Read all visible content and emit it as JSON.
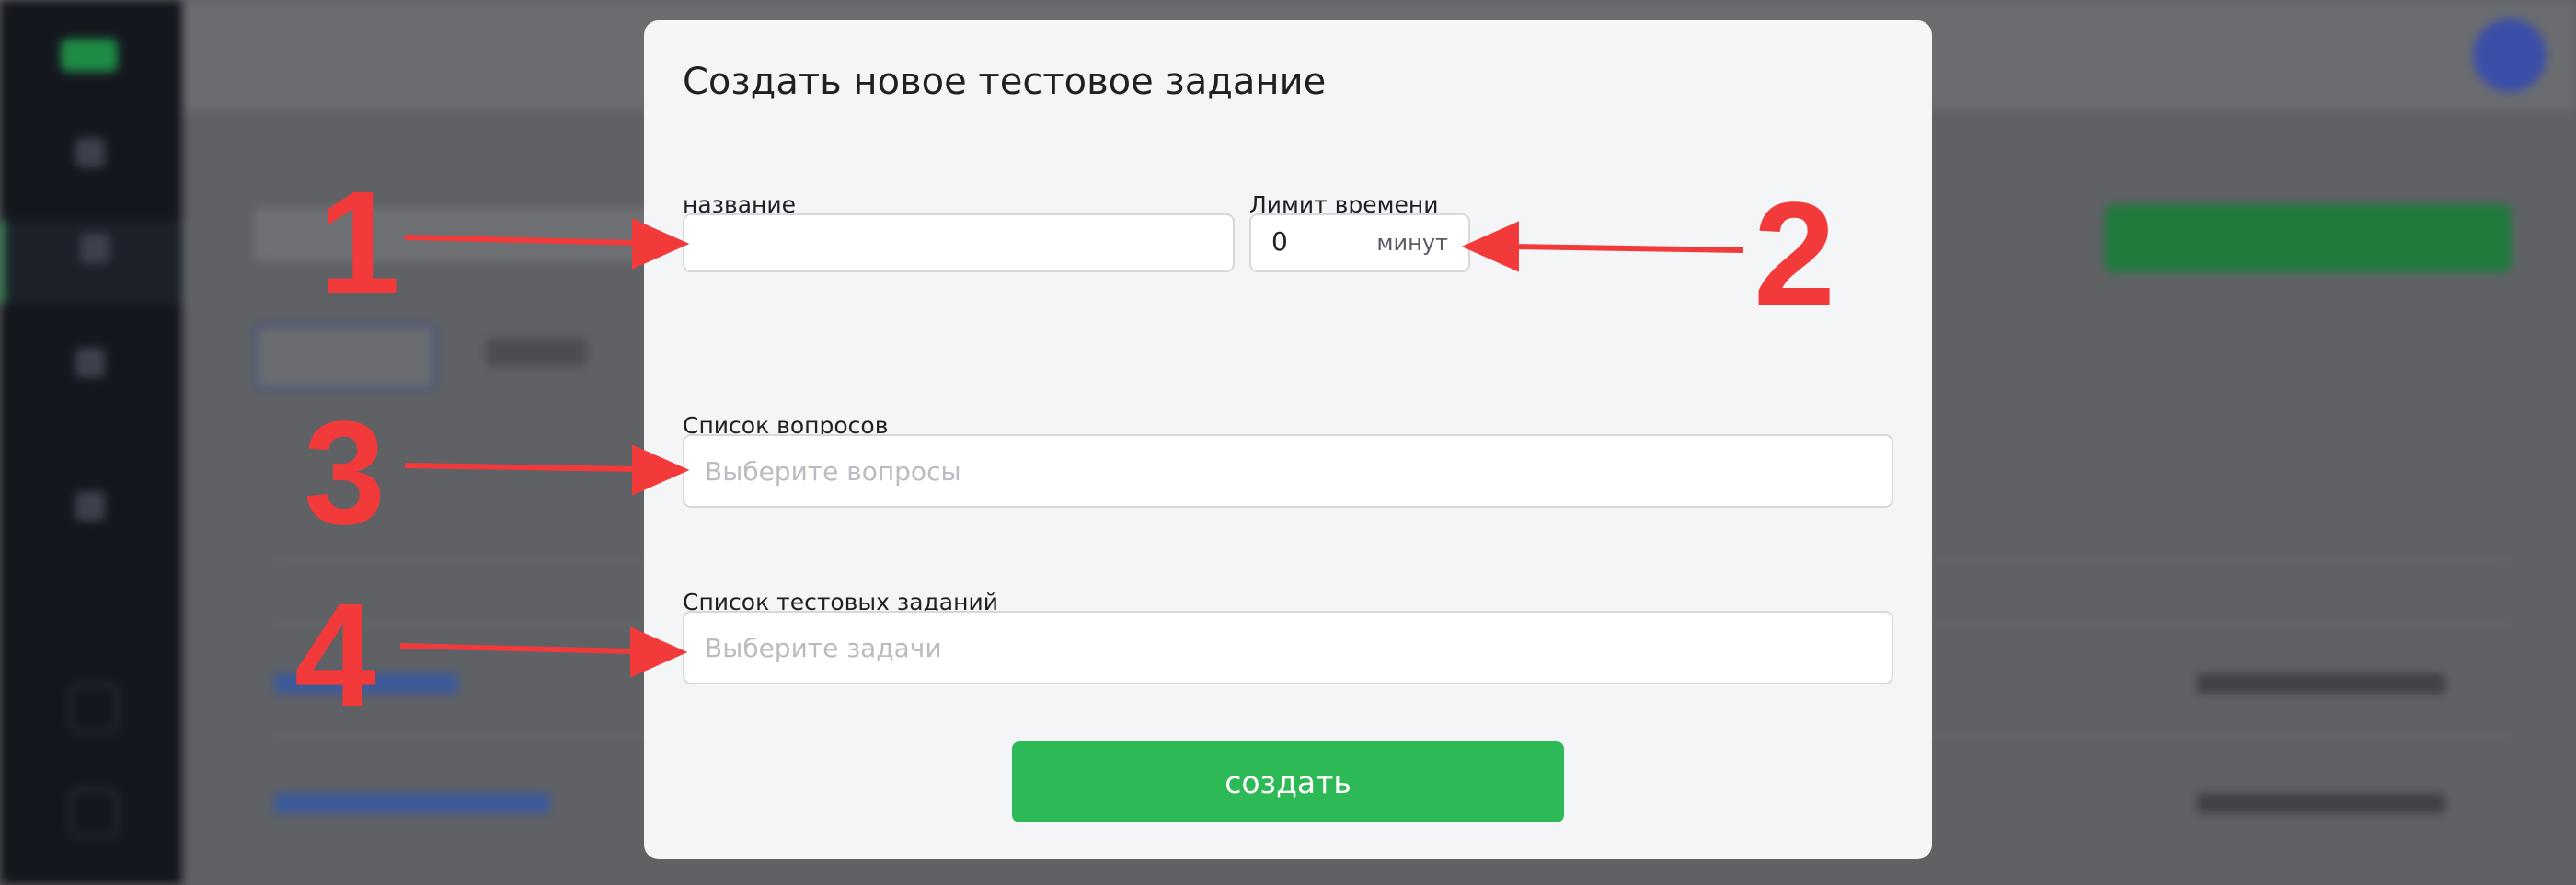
{
  "modal": {
    "title": "Создать новое тестовое задание",
    "name_label": "название",
    "time_label": "Лимит времени",
    "time_value": "0",
    "time_unit": "минут",
    "questions_label": "Список вопросов",
    "questions_placeholder": "Выберите вопросы",
    "tasks_label": "Список тестовых заданий",
    "tasks_placeholder": "Выберите задачи",
    "create_button": "создать"
  },
  "annotations": [
    "1",
    "2",
    "3",
    "4"
  ],
  "colors": {
    "accent_green": "#2dba56",
    "annotation_red": "#f23a3a",
    "overlay": "#5f6165"
  }
}
